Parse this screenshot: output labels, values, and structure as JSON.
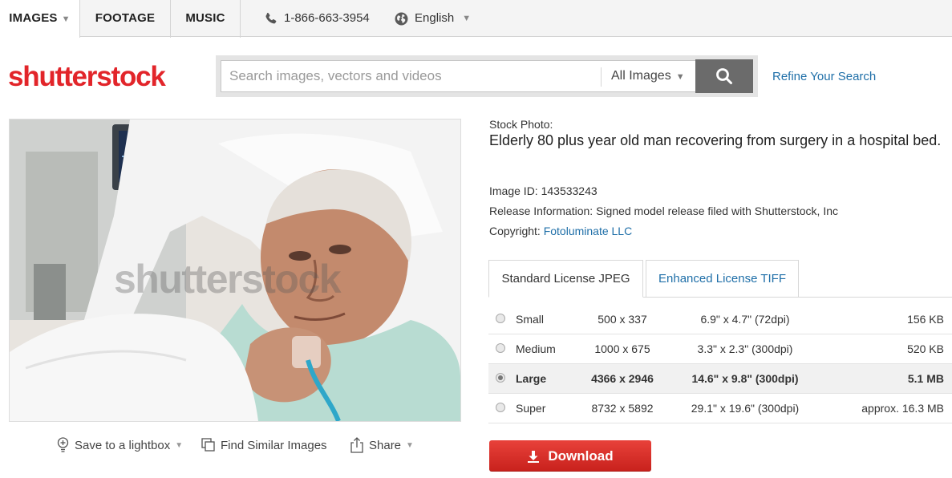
{
  "topnav": {
    "tabs": [
      {
        "label": "IMAGES",
        "has_caret": true,
        "active": true
      },
      {
        "label": "FOOTAGE",
        "active": false
      },
      {
        "label": "MUSIC",
        "active": false
      }
    ],
    "phone": "1-866-663-3954",
    "language": "English"
  },
  "header": {
    "logo_text": "shutterstock",
    "search_placeholder": "Search images, vectors and videos",
    "search_value": "",
    "scope_selected": "All Images",
    "refine_label": "Refine Your Search"
  },
  "image": {
    "watermark": "shutterstock",
    "actions": {
      "save": "Save to a lightbox",
      "similar": "Find Similar Images",
      "share": "Share"
    }
  },
  "details": {
    "label": "Stock Photo:",
    "title": "Elderly 80 plus year old man recovering from surgery in a hospital bed.",
    "image_id_label": "Image ID:",
    "image_id": "143533243",
    "release_label": "Release Information:",
    "release_value": "Signed model release filed with Shutterstock, Inc",
    "copyright_label": "Copyright:",
    "copyright_value": "Fotoluminate LLC"
  },
  "license": {
    "tabs": [
      "Standard License JPEG",
      "Enhanced License TIFF"
    ],
    "active_tab": 0,
    "sizes": [
      {
        "name": "Small",
        "pixels": "500 x 337",
        "inches": "6.9\" x 4.7\" (72dpi)",
        "filesize": "156 KB",
        "selected": false
      },
      {
        "name": "Medium",
        "pixels": "1000 x 675",
        "inches": "3.3\" x 2.3\" (300dpi)",
        "filesize": "520 KB",
        "selected": false
      },
      {
        "name": "Large",
        "pixels": "4366 x 2946",
        "inches": "14.6\" x 9.8\" (300dpi)",
        "filesize": "5.1 MB",
        "selected": true
      },
      {
        "name": "Super",
        "pixels": "8732 x 5892",
        "inches": "29.1\" x 19.6\" (300dpi)",
        "filesize": "approx. 16.3 MB",
        "selected": false
      }
    ],
    "download_label": "Download"
  },
  "colors": {
    "brand_red": "#e2252a",
    "link_blue": "#1f6fa8",
    "search_button": "#6b6b6b",
    "download_red": "#d42e27"
  }
}
